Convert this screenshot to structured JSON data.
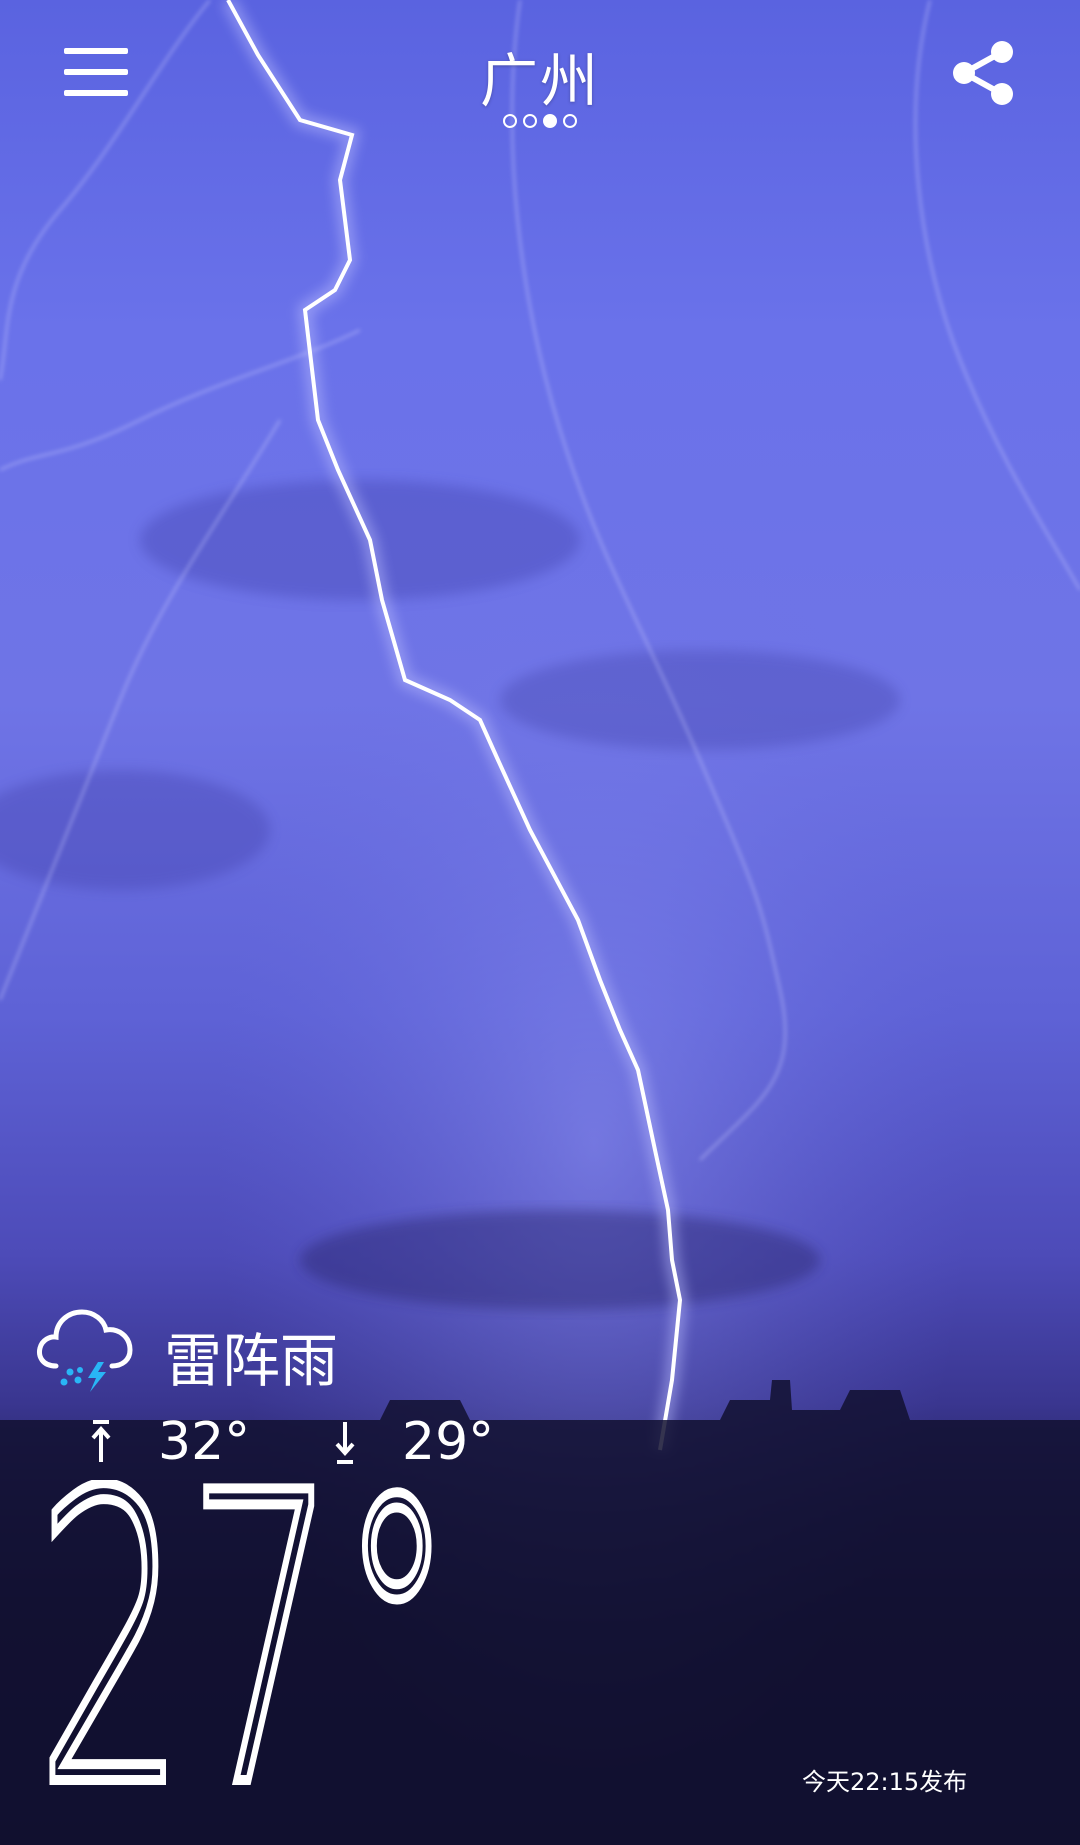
{
  "header": {
    "city": "广州",
    "page_count": 4,
    "active_page_index": 2
  },
  "weather": {
    "condition": "雷阵雨",
    "condition_icon": "thunderstorm-rain-icon",
    "high": "32°",
    "low": "29°",
    "current_temp": "27°",
    "publish_time": "今天22:15发布"
  },
  "icons": {
    "menu": "menu-icon",
    "share": "share-icon",
    "high_arrow": "arrow-up-icon",
    "low_arrow": "arrow-down-icon"
  },
  "colors": {
    "sky_top": "#5a63e0",
    "sky_bottom": "#100f2c",
    "text": "#ffffff",
    "rain_drop": "#29b6f6"
  }
}
